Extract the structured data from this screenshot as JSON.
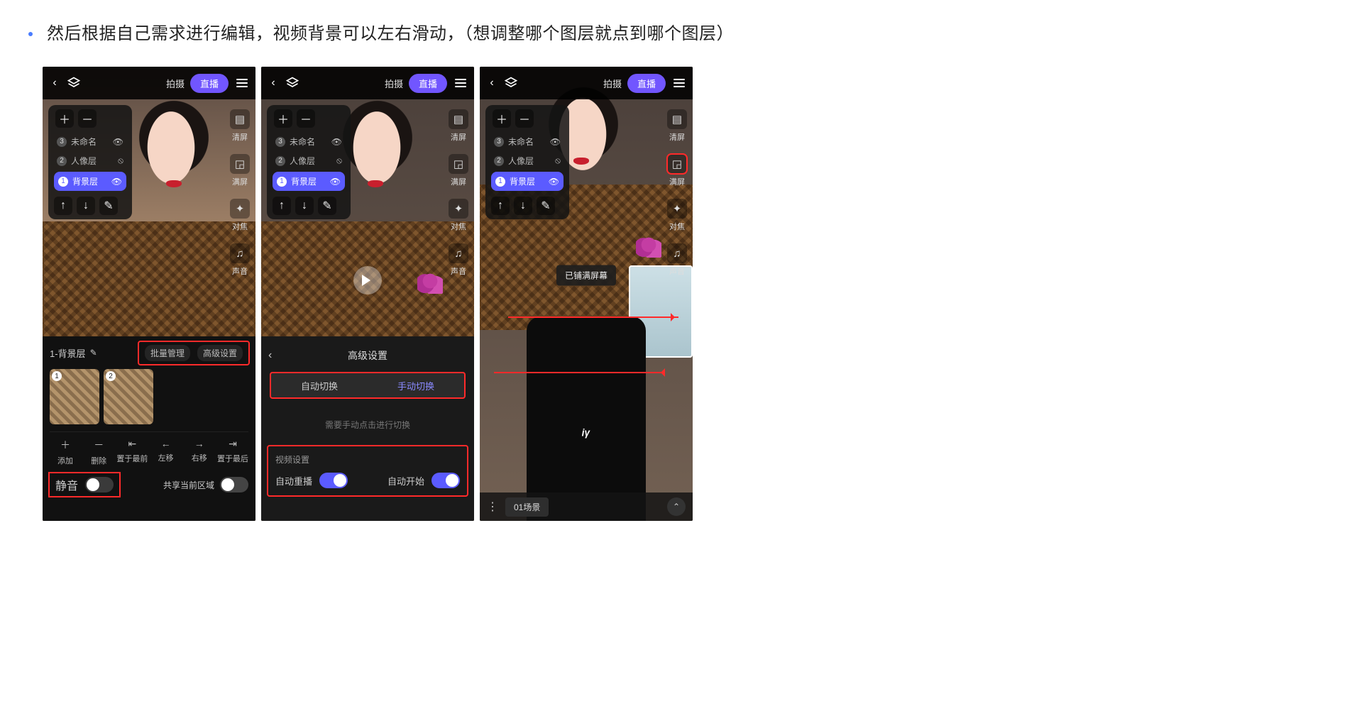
{
  "instruction": "然后根据自己需求进行编辑，视频背景可以左右滑动，（想调整哪个图层就点到哪个图层）",
  "topbar": {
    "shoot": "拍摄",
    "live": "直播"
  },
  "rightTools": {
    "clear": "清屏",
    "full": "满屏",
    "focus": "对焦",
    "sound": "声音"
  },
  "layers": {
    "item3": "未命名",
    "item2": "人像层",
    "item1": "背景层",
    "num3": "3",
    "num2": "2",
    "num1": "1"
  },
  "editor1": {
    "title": "1-背景层",
    "batch": "批量管理",
    "advanced": "高级设置",
    "ops": {
      "add": "添加",
      "del": "删除",
      "front": "置于最前",
      "left": "左移",
      "right": "右移",
      "back": "置于最后"
    },
    "mute": "静音",
    "share": "共享当前区域"
  },
  "editor2": {
    "title": "高级设置",
    "auto": "自动切换",
    "manual": "手动切换",
    "hint": "需要手动点击进行切换",
    "vidset": "视频设置",
    "autoreplay": "自动重播",
    "autostart": "自动开始"
  },
  "shot3": {
    "toast": "已铺满屏幕",
    "scene": "01场景"
  }
}
